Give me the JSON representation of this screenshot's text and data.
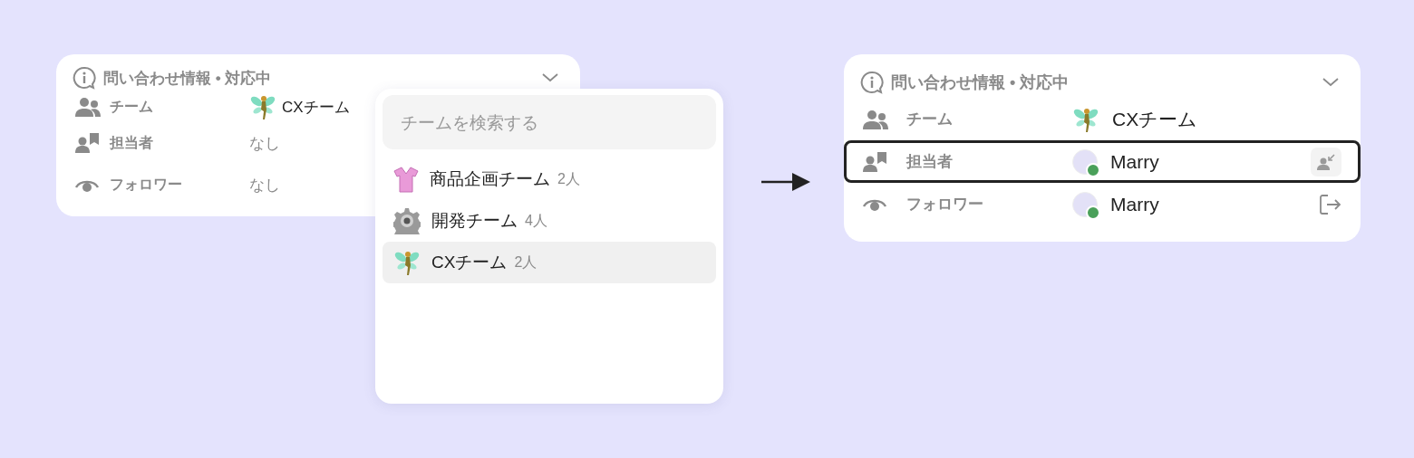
{
  "before": {
    "header": {
      "title": "問い合わせ情報 • 対応中"
    },
    "rows": [
      {
        "label": "チーム",
        "value": {
          "kind": "team",
          "text": "CXチーム"
        }
      },
      {
        "label": "担当者",
        "value": {
          "kind": "empty",
          "text": "なし"
        }
      },
      {
        "label": "フォロワー",
        "value": {
          "kind": "empty",
          "text": "なし"
        }
      }
    ],
    "dropdown": {
      "search": {
        "placeholder": "チームを検索する"
      },
      "items": [
        {
          "name": "商品企画チーム",
          "count": "2人",
          "selected": false
        },
        {
          "name": "開発チーム",
          "count": "4人",
          "selected": false
        },
        {
          "name": "CXチーム",
          "count": "2人",
          "selected": true
        }
      ]
    }
  },
  "after": {
    "header": {
      "title": "問い合わせ情報 • 対応中"
    },
    "rows": [
      {
        "label": "チーム",
        "highlighted": false,
        "value": {
          "kind": "team",
          "text": "CXチーム"
        }
      },
      {
        "label": "担当者",
        "highlighted": true,
        "value": {
          "kind": "user",
          "online": true,
          "text": "Marry"
        }
      },
      {
        "label": "フォロワー",
        "highlighted": false,
        "value": {
          "kind": "user",
          "online": true,
          "text": "Marry"
        }
      }
    ]
  }
}
